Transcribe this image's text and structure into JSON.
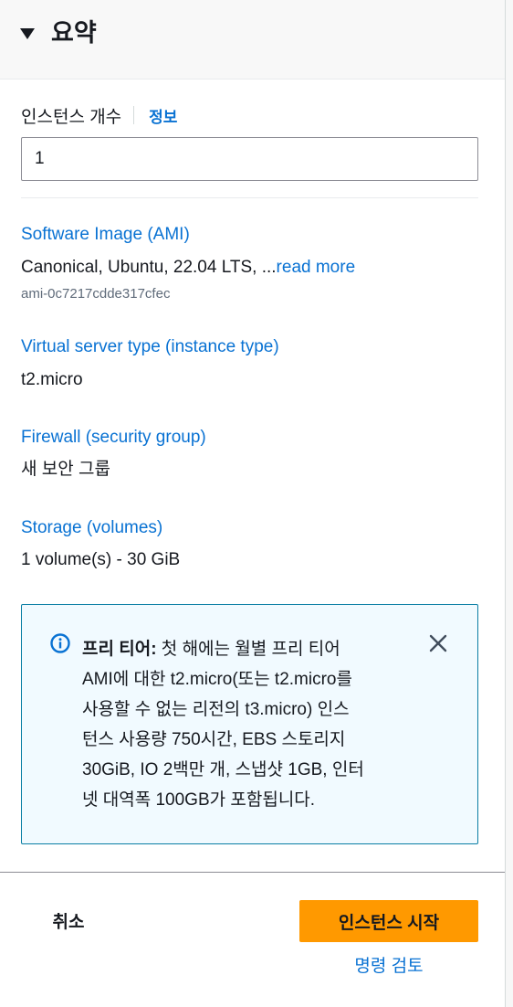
{
  "summary": {
    "title": "요약"
  },
  "instance_count": {
    "label": "인스턴스 개수",
    "info_link": "정보",
    "value": "1"
  },
  "software_image": {
    "title": "Software Image (AMI)",
    "value": "Canonical, Ubuntu, 22.04 LTS, ...",
    "read_more": "read more",
    "ami_id": "ami-0c7217cdde317cfec"
  },
  "instance_type": {
    "title": "Virtual server type (instance type)",
    "value": "t2.micro"
  },
  "firewall": {
    "title": "Firewall (security group)",
    "value": "새 보안 그룹"
  },
  "storage": {
    "title": "Storage (volumes)",
    "value": "1 volume(s) - 30 GiB"
  },
  "free_tier_alert": {
    "heading": "프리 티어:",
    "line1": " 첫 해에는 월별 프리 티어",
    "line2": "AMI에 대한 t2.micro(또는 t2.micro를",
    "line3": "사용할 수 없는 리전의 t3.micro) 인스",
    "line4": "턴스 사용량 750시간, EBS 스토리지",
    "line5": "30GiB, IO 2백만 개, 스냅샷 1GB, 인터",
    "line6": "넷 대역폭 100GB가 포함됩니다.",
    "icon": "info-icon",
    "close_icon": "close-icon"
  },
  "footer": {
    "cancel_label": "취소",
    "launch_label": "인스턴스 시작",
    "review_label": "명령 검토"
  },
  "colors": {
    "accent_link": "#0972d3",
    "primary_button": "#ff9900",
    "alert_background": "#f1faff",
    "alert_border": "#0a7ea4"
  }
}
